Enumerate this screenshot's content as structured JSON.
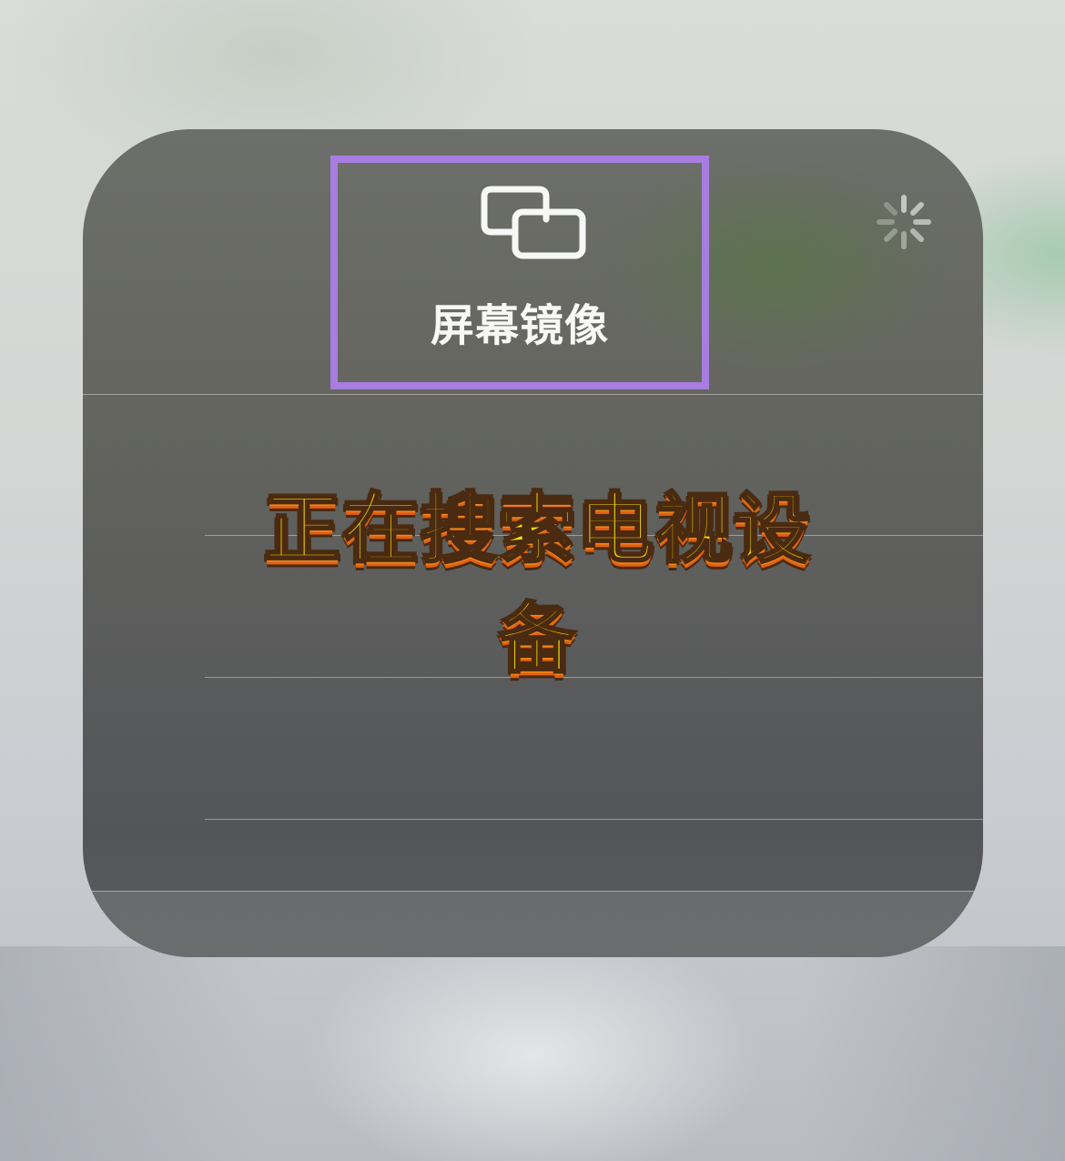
{
  "screen_mirroring": {
    "title": "屏幕镜像",
    "icon": "screen-mirroring-icon",
    "status_icon": "loading-spinner-icon",
    "highlight_color": "#a77de0"
  },
  "overlay": {
    "caption": "正在搜索电视设备",
    "caption_color": "#ffe100",
    "caption_outline_color": "#4a2a10"
  }
}
